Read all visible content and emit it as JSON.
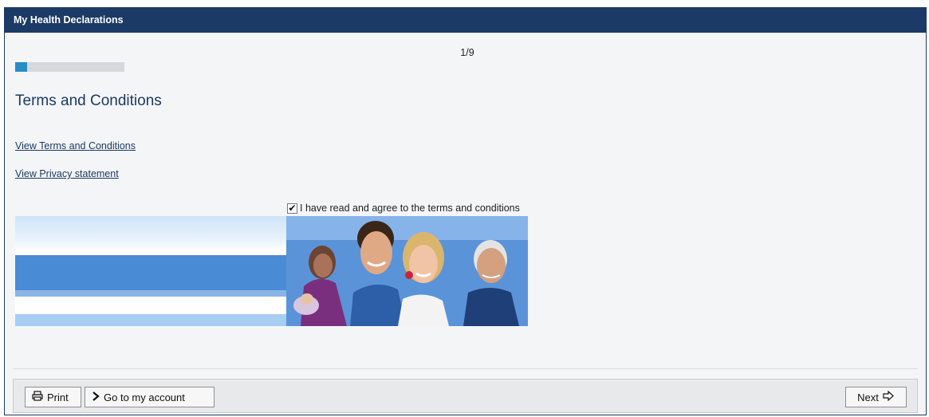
{
  "window": {
    "title": "My Health Declarations"
  },
  "wizard": {
    "step_text": "1/9",
    "progress": 0.11,
    "page_title": "Terms and Conditions",
    "links": {
      "terms": "View Terms and Conditions",
      "privacy": "View Privacy statement"
    },
    "agree": {
      "label": "I have read and agree to the terms and conditions",
      "checked": true
    }
  },
  "footer": {
    "print_label": "Print",
    "account_label": "Go to my account",
    "next_label": "Next"
  },
  "icons": {
    "print": "printer-icon",
    "account": "chevron-right-icon",
    "next": "arrow-right-icon"
  },
  "colors": {
    "titlebar": "#1b3a66",
    "progress_fill": "#2a8cc4",
    "banner_blue": "#4a8bd6"
  }
}
